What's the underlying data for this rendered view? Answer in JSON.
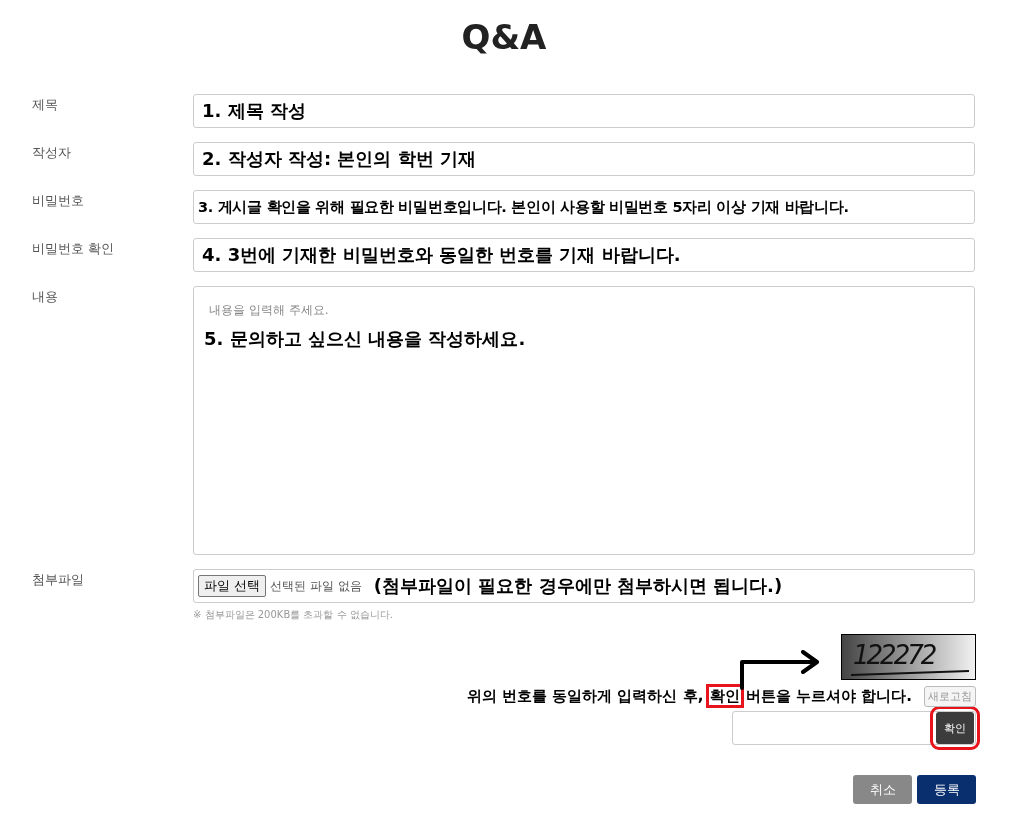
{
  "title": "Q&A",
  "fields": [
    {
      "label": "제목",
      "value": "1. 제목 작성",
      "kind": "input"
    },
    {
      "label": "작성자",
      "value": "2. 작성자 작성: 본인의 학번 기재",
      "kind": "input"
    },
    {
      "label": "비밀번호",
      "value": "3. 게시글 확인을 위해 필요한 비밀번호입니다. 본인이 사용할 비밀번호 5자리 이상 기재 바랍니다.",
      "kind": "input-small"
    },
    {
      "label": "비밀번호 확인",
      "value": "4. 3번에 기재한 비밀번호와 동일한 번호를 기재 바랍니다.",
      "kind": "input"
    },
    {
      "label": "내용",
      "placeholder": "내용을 입력해 주세요.",
      "value": "5. 문의하고 싶으신 내용을 작성하세요.",
      "kind": "textarea"
    }
  ],
  "attachment": {
    "label": "첨부파일",
    "button": "파일 선택",
    "status": "선택된 파일 없음",
    "annotation": "(첨부파일이 필요한 경우에만 첨부하시면 됩니다.)",
    "note": "※ 첨부파일은 200KB를 초과할 수 없습니다."
  },
  "captcha": {
    "code": "122272",
    "instruction_before": "위의 번호를 동일하게 입력하신 후,",
    "instruction_highlight": "확인",
    "instruction_after": "버튼을 누르셔야 합니다.",
    "refresh_button": "새로고침",
    "confirm_button": "확인"
  },
  "buttons": [
    {
      "label": "취소",
      "kind": "cancel"
    },
    {
      "label": "등록",
      "kind": "submit"
    }
  ]
}
